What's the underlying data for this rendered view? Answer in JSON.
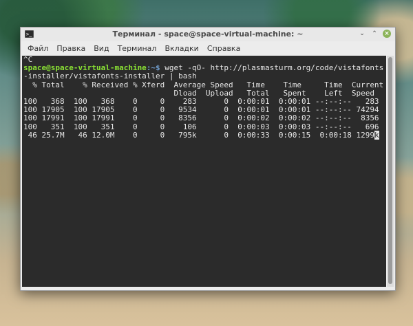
{
  "window": {
    "title": "Терминал - space@space-virtual-machine: ~"
  },
  "menu": {
    "items": [
      "Файл",
      "Правка",
      "Вид",
      "Терминал",
      "Вкладки",
      "Справка"
    ]
  },
  "terminal": {
    "line_interrupt": "^C",
    "prompt_user": "space@space-virtual-machine",
    "prompt_path": ":~$",
    "command_line1": " wget -qO- http://plasmasturm.org/code/vistafonts",
    "command_line2": "-installer/vistafonts-installer | bash",
    "header1": "  % Total    % Received % Xferd  Average Speed   Time    Time     Time  Current",
    "header2": "                                 Dload  Upload   Total   Spent    Left  Speed",
    "rows": [
      "100   368  100   368    0     0    283      0  0:00:01  0:00:01 --:--:--   283",
      "100 17905  100 17905    0     0   9534      0  0:00:01  0:00:01 --:--:-- 74294",
      "100 17991  100 17991    0     0   8356      0  0:00:02  0:00:02 --:--:--  8356",
      "100   351  100   351    0     0    106      0  0:00:03  0:00:03 --:--:--   696"
    ],
    "last_row": " 46 25.7M   46 12.0M    0     0   795k      0  0:00:33  0:00:15  0:00:18 1299",
    "cursor_char": "k"
  }
}
